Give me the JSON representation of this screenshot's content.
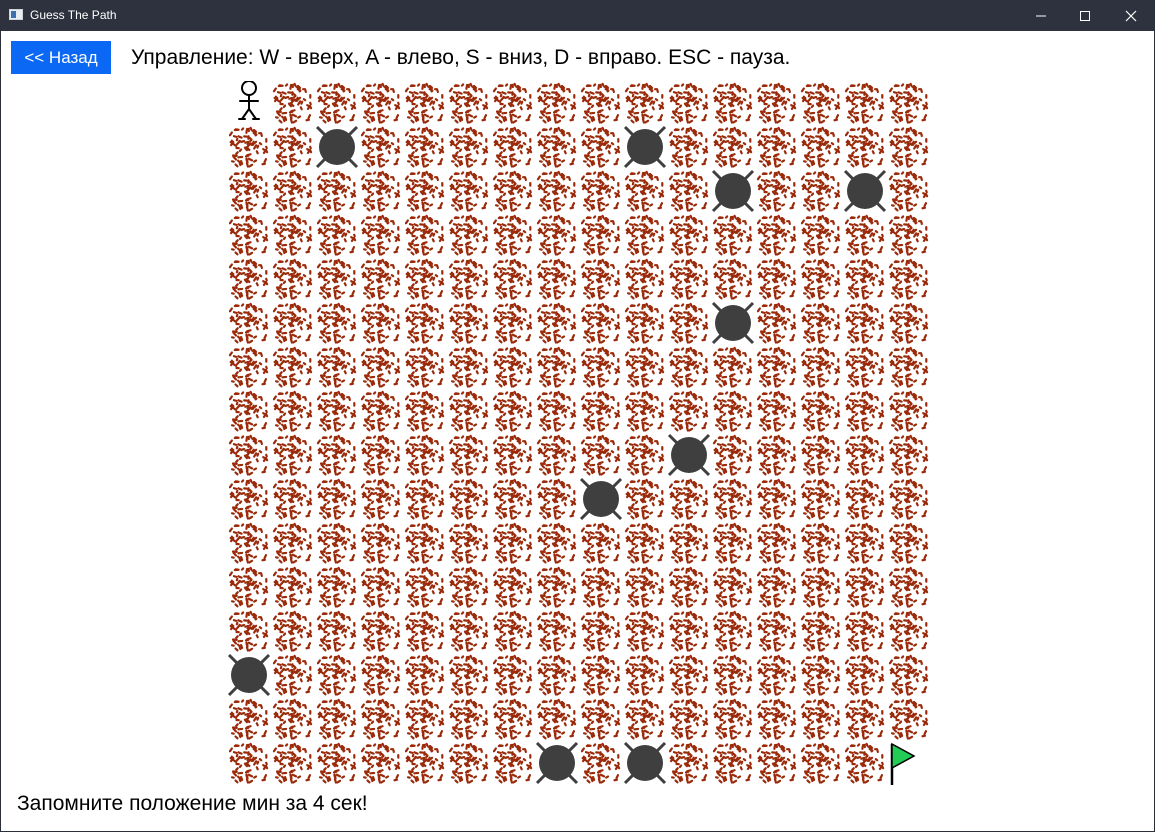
{
  "window": {
    "title": "Guess The Path",
    "icon": "app-window-icon",
    "controls": [
      "minimize-icon",
      "maximize-icon",
      "close-icon"
    ]
  },
  "toolbar": {
    "back_label": "<< Назад"
  },
  "instructions": "Управление: W - вверх, A - влево, S - вниз, D - вправо. ESC - пауза.",
  "status": "Запомните положение мин за 4 сек!",
  "board": {
    "rows": 16,
    "cols": 16,
    "tile": "dirt",
    "colors": {
      "dirt_speck": "#9a2a0a",
      "mine": "#3f3f3f",
      "flag": "#22cc55",
      "tile_bg": "#ffffff"
    },
    "player": {
      "row": 0,
      "col": 0
    },
    "goal": {
      "row": 15,
      "col": 15
    },
    "mines": [
      {
        "row": 1,
        "col": 2
      },
      {
        "row": 1,
        "col": 9
      },
      {
        "row": 2,
        "col": 11
      },
      {
        "row": 2,
        "col": 14
      },
      {
        "row": 5,
        "col": 11
      },
      {
        "row": 8,
        "col": 10
      },
      {
        "row": 9,
        "col": 8
      },
      {
        "row": 13,
        "col": 0
      },
      {
        "row": 15,
        "col": 7
      },
      {
        "row": 15,
        "col": 9
      }
    ]
  }
}
